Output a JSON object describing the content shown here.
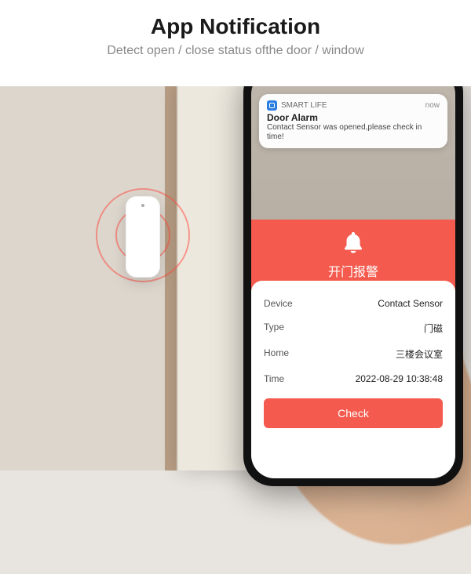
{
  "header": {
    "title": "App Notification",
    "subtitle": "Detect open / close status ofthe door / window"
  },
  "notification": {
    "app_name": "SMART LIFE",
    "timestamp_label": "now",
    "title": "Door Alarm",
    "body": "Contact Sensor was opened,please check in time!"
  },
  "alarm_banner": {
    "label": "开门报警"
  },
  "details": {
    "device_label": "Device",
    "device_value": "Contact Sensor",
    "type_label": "Type",
    "type_value": "门磁",
    "home_label": "Home",
    "home_value": "三楼会议室",
    "time_label": "Time",
    "time_value": "2022-08-29 10:38:48",
    "check_button": "Check"
  }
}
